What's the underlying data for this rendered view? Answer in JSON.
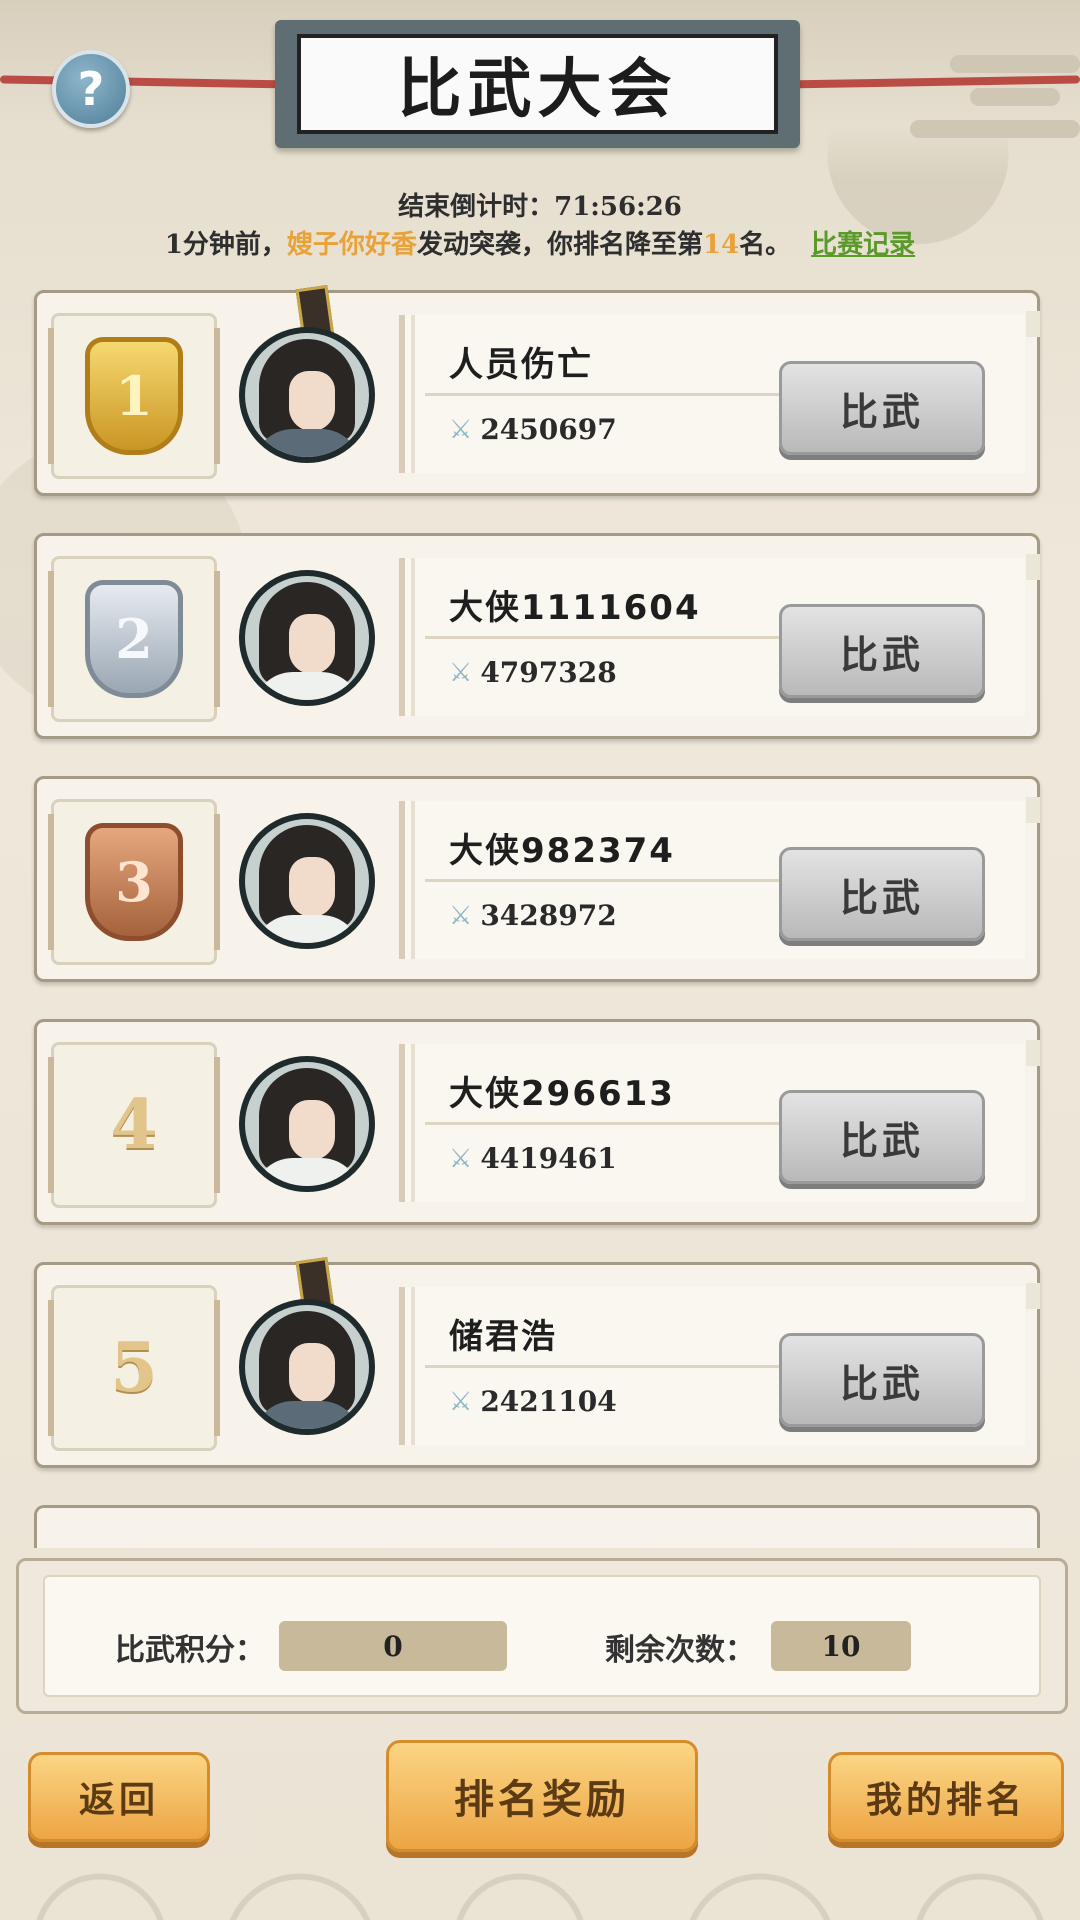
{
  "header": {
    "title": "比武大会",
    "help_label": "?"
  },
  "status": {
    "countdown_label": "结束倒计时：",
    "countdown_value": "71:56:26",
    "news_time": "1分钟前，",
    "news_attacker": "嫂子你好香",
    "news_action": "发动突袭，你排名降至第",
    "news_rank": "14",
    "news_suffix": "名。",
    "record_link": "比赛记录"
  },
  "rankings": [
    {
      "rank": "1",
      "badge": "gold-medal-icon",
      "name": "人员伤亡",
      "power": "2450697",
      "button": "比武",
      "crown": true,
      "robe": "dark"
    },
    {
      "rank": "2",
      "badge": "silver-medal-icon",
      "name": "大侠1111604",
      "power": "4797328",
      "button": "比武",
      "crown": false,
      "robe": "light"
    },
    {
      "rank": "3",
      "badge": "bronze-medal-icon",
      "name": "大侠982374",
      "power": "3428972",
      "button": "比武",
      "crown": false,
      "robe": "light"
    },
    {
      "rank": "4",
      "badge": "",
      "name": "大侠296613",
      "power": "4419461",
      "button": "比武",
      "crown": false,
      "robe": "light"
    },
    {
      "rank": "5",
      "badge": "",
      "name": "储君浩",
      "power": "2421104",
      "button": "比武",
      "crown": true,
      "robe": "dark"
    }
  ],
  "score_panel": {
    "points_label": "比武积分：",
    "points_value": "0",
    "remaining_label": "剩余次数：",
    "remaining_value": "10"
  },
  "bottom_nav": {
    "back": "返回",
    "rewards": "排名奖励",
    "my_rank": "我的排名"
  },
  "colors": {
    "highlight": "#e8a23a",
    "link": "#5a9a2a",
    "button_orange": "#eda544"
  }
}
